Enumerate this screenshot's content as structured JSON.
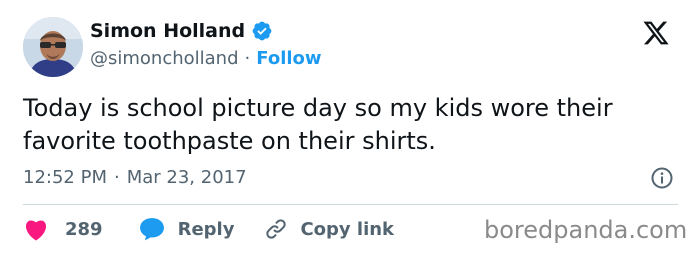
{
  "author": {
    "name": "Simon Holland",
    "handle": "@simoncholland",
    "separator": "·",
    "follow_label": "Follow",
    "avatar_icon": "user-avatar",
    "verified_icon": "verified-badge-icon"
  },
  "platform": {
    "logo_icon": "x-logo-icon"
  },
  "tweet": {
    "text": "Today is school picture day so my kids wore their\nfavorite toothpaste on their shirts.",
    "time": "12:52 PM",
    "separator": "·",
    "date": "Mar 23, 2017",
    "info_icon": "info-icon"
  },
  "actions": {
    "like_count": "289",
    "like_icon": "heart-icon",
    "reply_label": "Reply",
    "reply_icon": "speech-bubble-icon",
    "copy_label": "Copy link",
    "copy_icon": "link-icon"
  },
  "watermark": {
    "text": "boredpanda.com"
  },
  "colors": {
    "accent": "#1d9bf0",
    "like": "#f91880",
    "muted": "#536471",
    "text": "#0f1419"
  }
}
